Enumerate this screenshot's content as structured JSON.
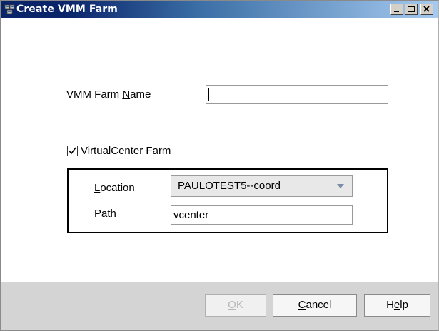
{
  "window": {
    "title": "Create VMM Farm",
    "icon": "cluster-app-icon",
    "controls": [
      "minimize",
      "maximize",
      "close"
    ]
  },
  "form": {
    "farm_name_label": "VMM Farm Name",
    "farm_name_mnemonic": "N",
    "farm_name_value": "",
    "virtualcenter_label": "VirtualCenter Farm",
    "virtualcenter_checked": true,
    "location_label": "Location",
    "location_value": "PAULOTEST5--coord",
    "path_label": "Path",
    "path_value": "vcenter"
  },
  "buttons": {
    "ok": {
      "label": "OK",
      "enabled": false
    },
    "cancel": {
      "label": "Cancel"
    },
    "help": {
      "label": "Help"
    }
  },
  "colors": {
    "titlebar_start": "#0a246a",
    "titlebar_end": "#a6caf0",
    "footer": "#d4d4d4"
  }
}
